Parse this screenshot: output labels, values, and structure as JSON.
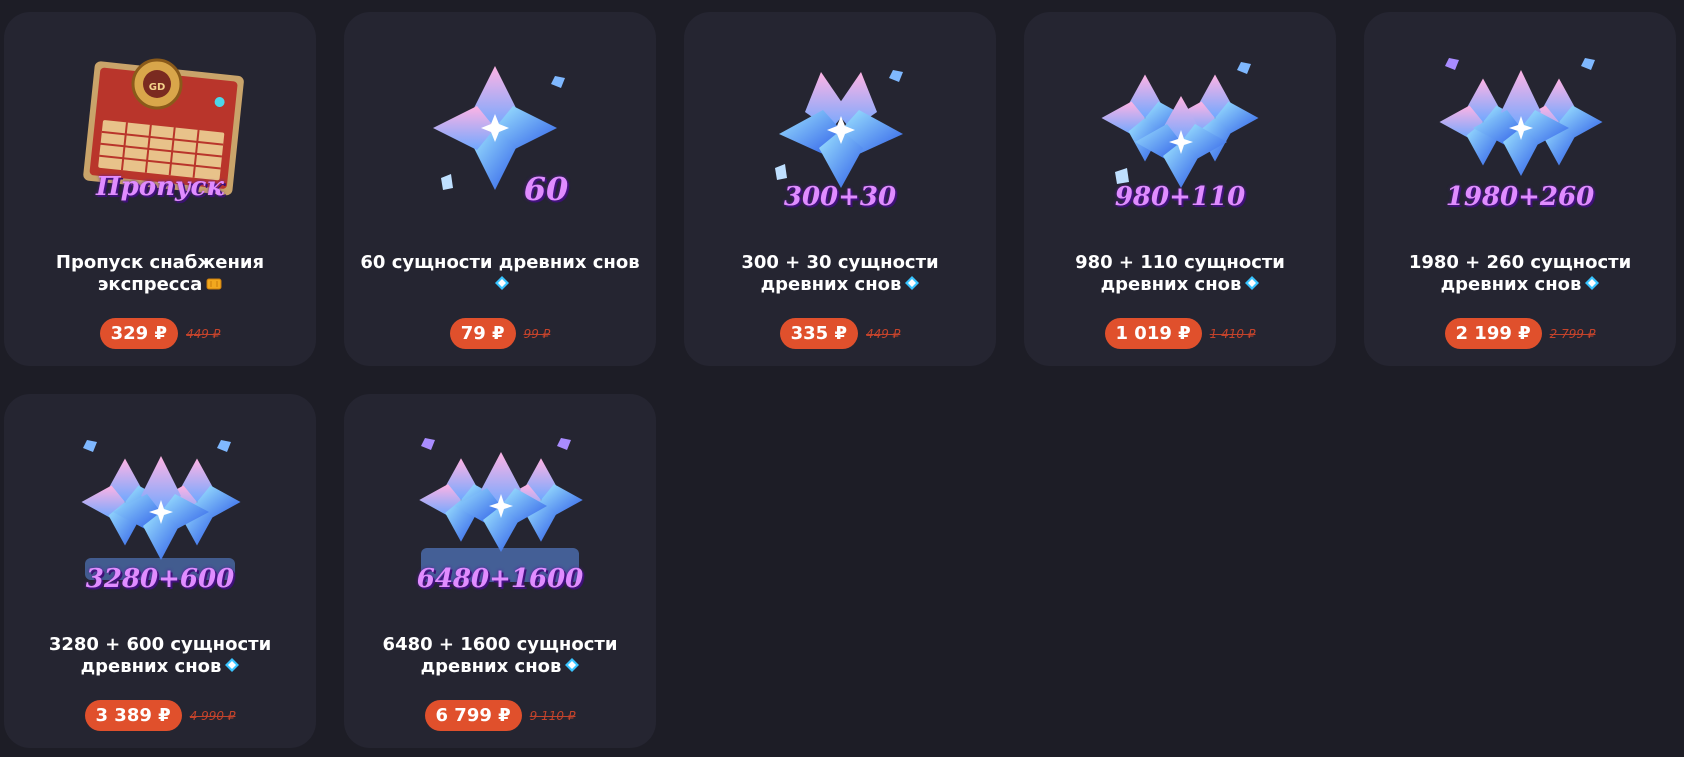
{
  "products": [
    {
      "title": "Пропуск снабжения экспресса",
      "title_icon": "ticket-icon",
      "badge": "Пропуск",
      "price": "329 ₽",
      "old_price": "449 ₽"
    },
    {
      "title": "60 сущности древних снов",
      "title_icon": "dream-essence-icon",
      "badge": "60",
      "price": "79 ₽",
      "old_price": "99 ₽"
    },
    {
      "title": "300 + 30 сущности древних снов",
      "title_icon": "dream-essence-icon",
      "badge": "300+30",
      "price": "335 ₽",
      "old_price": "449 ₽"
    },
    {
      "title": "980 + 110 сущности древних снов",
      "title_icon": "dream-essence-icon",
      "badge": "980+110",
      "price": "1 019 ₽",
      "old_price": "1 410 ₽"
    },
    {
      "title": "1980 + 260 сущности древних снов",
      "title_icon": "dream-essence-icon",
      "badge": "1980+260",
      "price": "2 199 ₽",
      "old_price": "2 799 ₽"
    },
    {
      "title": "3280 + 600 сущности древних снов",
      "title_icon": "dream-essence-icon",
      "badge": "3280+600",
      "price": "3 389 ₽",
      "old_price": "4 990 ₽"
    },
    {
      "title": "6480 + 1600 сущности древних снов",
      "title_icon": "dream-essence-icon",
      "badge": "6480+1600",
      "price": "6 799 ₽",
      "old_price": "9 110 ₽"
    }
  ]
}
